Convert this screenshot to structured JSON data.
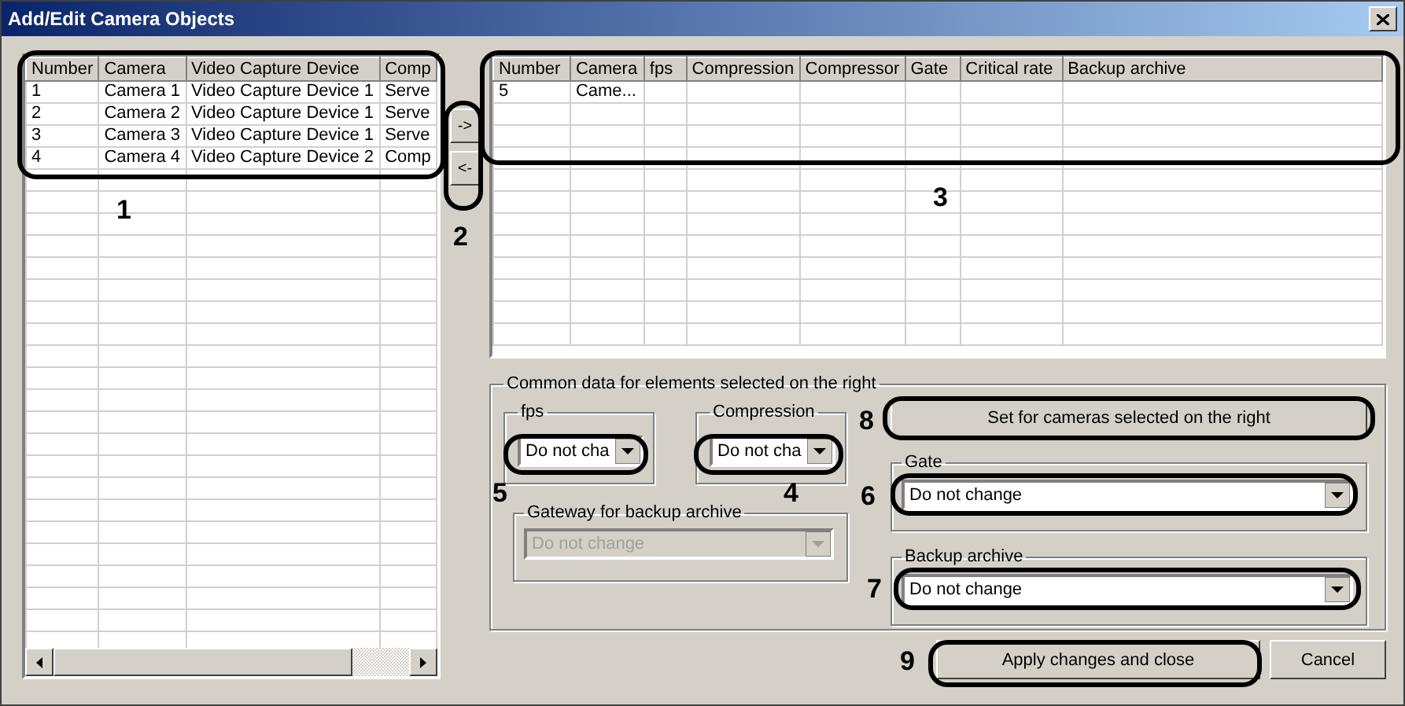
{
  "window": {
    "title": "Add/Edit Camera Objects"
  },
  "left_table": {
    "columns": [
      "Number",
      "Camera",
      "Video Capture Device",
      "Comp"
    ],
    "rows": [
      [
        "1",
        "Camera 1",
        "Video Capture Device 1",
        "Serve"
      ],
      [
        "2",
        "Camera 2",
        "Video Capture Device 1",
        "Serve"
      ],
      [
        "3",
        "Camera 3",
        "Video Capture Device 1",
        "Serve"
      ],
      [
        "4",
        "Camera 4",
        "Video Capture Device 2",
        "Comp"
      ]
    ]
  },
  "move_buttons": [
    "->",
    "<-"
  ],
  "right_table": {
    "columns": [
      "Number",
      "Camera",
      "fps",
      "Compression",
      "Compressor",
      "Gate",
      "Critical rate",
      "Backup archive"
    ],
    "rows": [
      [
        "5",
        "Came..."
      ]
    ]
  },
  "common_group": {
    "title": "Common data for elements selected on the right",
    "fps": {
      "label": "fps",
      "value": "Do not cha",
      "disabled": false
    },
    "compression": {
      "label": "Compression",
      "value": "Do not cha",
      "disabled": false
    },
    "gateway": {
      "label": "Gateway for backup archive",
      "value": "Do not change",
      "disabled": true
    },
    "set_button": "Set for cameras selected on the right",
    "gate": {
      "label": "Gate",
      "value": "Do not change",
      "disabled": false
    },
    "backup_archive": {
      "label": "Backup archive",
      "value": "Do not change",
      "disabled": false
    }
  },
  "buttons": {
    "apply": "Apply changes and close",
    "cancel": "Cancel"
  },
  "annotations": [
    {
      "label": "1"
    },
    {
      "label": "3"
    },
    {
      "label": "2"
    },
    {
      "label": "8"
    },
    {
      "label": "5"
    },
    {
      "label": "4"
    },
    {
      "label": "6"
    },
    {
      "label": "7"
    },
    {
      "label": "9"
    }
  ]
}
